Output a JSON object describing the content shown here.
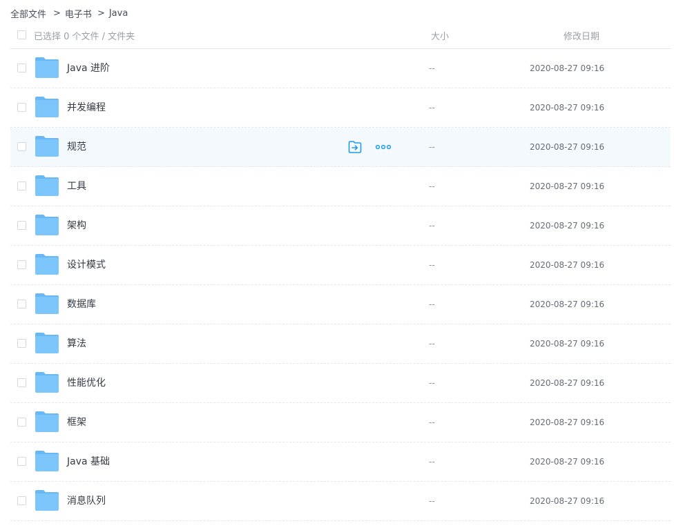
{
  "breadcrumb": {
    "root": "全部文件",
    "sep1": ">",
    "level1": "电子书",
    "sep2": ">",
    "current": "Java"
  },
  "header": {
    "selection": "已选择 0 个文件 / 文件夹",
    "size_col": "大小",
    "date_col": "修改日期"
  },
  "colors": {
    "folder": "#7cc6fb",
    "folder_tab": "#67b8f5",
    "action": "#1d9ce8",
    "hover_row": "#f4f9fe"
  },
  "files": [
    {
      "name": "Java 进阶",
      "size": "--",
      "modified": "2020-08-27 09:16"
    },
    {
      "name": "并发编程",
      "size": "--",
      "modified": "2020-08-27 09:16"
    },
    {
      "name": "规范",
      "size": "--",
      "modified": "2020-08-27 09:16"
    },
    {
      "name": "工具",
      "size": "--",
      "modified": "2020-08-27 09:16"
    },
    {
      "name": "架构",
      "size": "--",
      "modified": "2020-08-27 09:16"
    },
    {
      "name": "设计模式",
      "size": "--",
      "modified": "2020-08-27 09:16"
    },
    {
      "name": "数据库",
      "size": "--",
      "modified": "2020-08-27 09:16"
    },
    {
      "name": "算法",
      "size": "--",
      "modified": "2020-08-27 09:16"
    },
    {
      "name": "性能优化",
      "size": "--",
      "modified": "2020-08-27 09:16"
    },
    {
      "name": "框架",
      "size": "--",
      "modified": "2020-08-27 09:16"
    },
    {
      "name": "Java 基础",
      "size": "--",
      "modified": "2020-08-27 09:16"
    },
    {
      "name": "消息队列",
      "size": "--",
      "modified": "2020-08-27 09:16"
    }
  ],
  "hovered_row": 2,
  "row_actions": {
    "move_icon": "move-to-folder-icon",
    "more_icon": "more-options-icon"
  }
}
